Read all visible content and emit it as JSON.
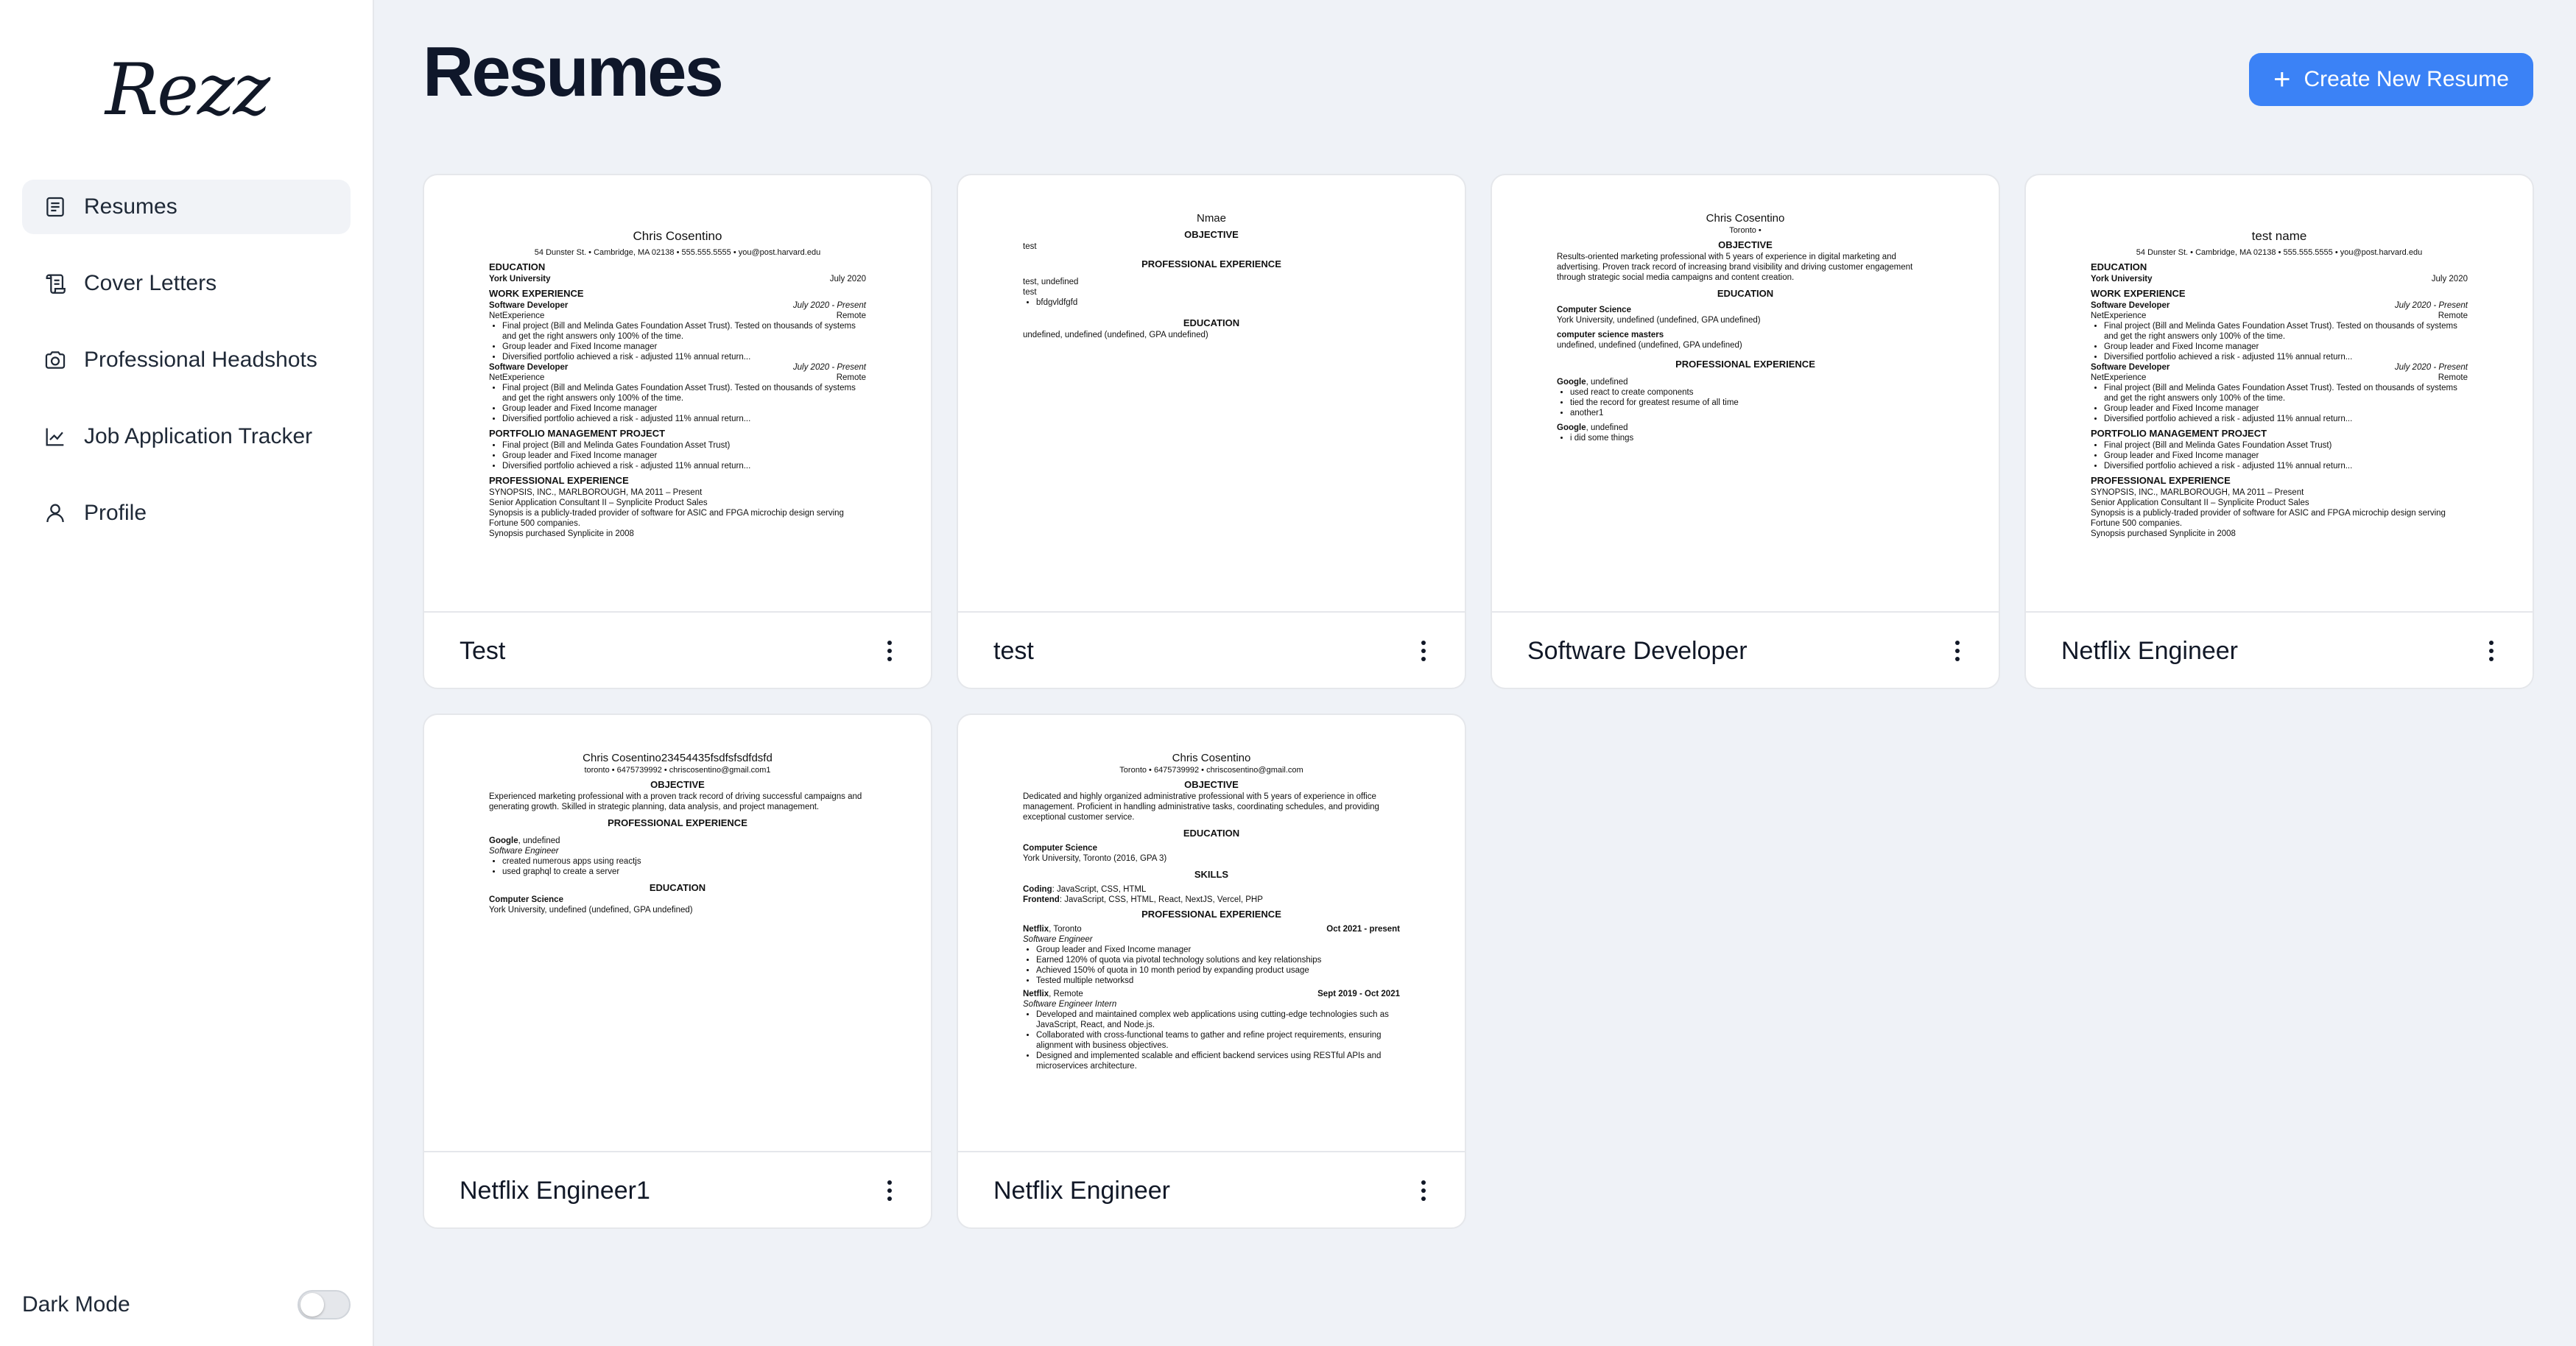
{
  "app": {
    "logo": "Rezz"
  },
  "sidebar": {
    "items": [
      {
        "label": "Resumes",
        "icon": "document-icon",
        "active": true
      },
      {
        "label": "Cover Letters",
        "icon": "scroll-icon",
        "active": false
      },
      {
        "label": "Professional Headshots",
        "icon": "camera-icon",
        "active": false
      },
      {
        "label": "Job Application Tracker",
        "icon": "chart-icon",
        "active": false
      },
      {
        "label": "Profile",
        "icon": "user-icon",
        "active": false
      }
    ],
    "dark_mode_label": "Dark Mode",
    "dark_mode_on": false
  },
  "header": {
    "title": "Resumes",
    "create_label": "Create New Resume",
    "accent": "#3b82f6"
  },
  "cards": [
    {
      "name": "Test",
      "preview": {
        "title": "Chris Cosentino",
        "contact": "54 Dunster St. • Cambridge, MA 02138 • 555.555.5555 • you@post.harvard.edu",
        "edu_heading": "EDUCATION",
        "edu_school": "York University",
        "edu_date": "July 2020",
        "work_heading": "WORK EXPERIENCE",
        "job1_title": "Software Developer",
        "job1_date": "July 2020 - Present",
        "job1_company": "NetExperience",
        "job1_loc": "Remote",
        "b1": "Final project (Bill and Melinda Gates Foundation Asset Trust). Tested on thousands of systems and get the right answers only 100% of the time.",
        "b2": "Group leader and Fixed Income manager",
        "b3": "Diversified portfolio achieved a risk - adjusted 11% annual return...",
        "proj_heading": "PORTFOLIO MANAGEMENT PROJECT",
        "pb1": "Final project (Bill and Melinda Gates Foundation Asset Trust)",
        "pb2": "Group leader and Fixed Income manager",
        "pb3": "Diversified portfolio achieved a risk - adjusted 11% annual return...",
        "pro_heading": "PROFESSIONAL EXPERIENCE",
        "pro1": "SYNOPSIS, INC., MARLBOROUGH, MA 2011 – Present",
        "pro2": "Senior Application Consultant II – Synplicite Product Sales",
        "pro3": "Synopsis is a publicly-traded provider of software for ASIC and FPGA microchip design serving Fortune 500 companies.",
        "pro4": "Synopsis purchased Synplicite in 2008"
      }
    },
    {
      "name": "test",
      "preview": {
        "title": "Nmae",
        "obj_heading": "OBJECTIVE",
        "obj_text": "test",
        "pro_heading": "PROFESSIONAL EXPERIENCE",
        "job_line": "test, undefined",
        "job_sub": "test",
        "bullet": "bfdgvldfgfd",
        "edu_heading": "EDUCATION",
        "edu_line": "undefined, undefined (undefined, GPA undefined)"
      }
    },
    {
      "name": "Software Developer",
      "preview": {
        "title": "Chris Cosentino",
        "contact": "Toronto •",
        "obj_heading": "OBJECTIVE",
        "obj_text": "Results-oriented marketing professional with 5 years of experience in digital marketing and advertising. Proven track record of increasing brand visibility and driving customer engagement through strategic social media campaigns and content creation.",
        "edu_heading": "EDUCATION",
        "edu1_title": "Computer Science",
        "edu1_line": "York University, undefined (undefined, GPA undefined)",
        "edu2_title": "computer science masters",
        "edu2_line": "undefined, undefined (undefined, GPA undefined)",
        "pro_heading": "PROFESSIONAL EXPERIENCE",
        "job1_company": "Google",
        "job1_rest": ", undefined",
        "b1": "used react to create components",
        "b2": "tied the record for greatest resume of all time",
        "b3": "another1",
        "job2_company": "Google",
        "job2_rest": ", undefined",
        "b4": "i did some things"
      }
    },
    {
      "name": "Netflix Engineer",
      "preview": {
        "title": "test name",
        "contact": "54 Dunster St. • Cambridge, MA 02138 • 555.555.5555 • you@post.harvard.edu",
        "edu_heading": "EDUCATION",
        "edu_school": "York University",
        "edu_date": "July 2020",
        "work_heading": "WORK EXPERIENCE",
        "job1_title": "Software Developer",
        "job1_date": "July 2020 - Present",
        "job1_company": "NetExperience",
        "job1_loc": "Remote",
        "b1": "Final project (Bill and Melinda Gates Foundation Asset Trust). Tested on thousands of systems and get the right answers only 100% of the time.",
        "b2": "Group leader and Fixed Income manager",
        "b3": "Diversified portfolio achieved a risk - adjusted 11% annual return...",
        "proj_heading": "PORTFOLIO MANAGEMENT PROJECT",
        "pb1": "Final project (Bill and Melinda Gates Foundation Asset Trust)",
        "pb2": "Group leader and Fixed Income manager",
        "pb3": "Diversified portfolio achieved a risk - adjusted 11% annual return...",
        "pro_heading": "PROFESSIONAL EXPERIENCE",
        "pro1": "SYNOPSIS, INC., MARLBOROUGH, MA 2011 – Present",
        "pro2": "Senior Application Consultant II – Synplicite Product Sales",
        "pro3": "Synopsis is a publicly-traded provider of software for ASIC and FPGA microchip design serving Fortune 500 companies.",
        "pro4": "Synopsis purchased Synplicite in 2008"
      }
    },
    {
      "name": "Netflix Engineer1",
      "preview": {
        "title": "Chris Cosentino23454435fsdfsfsdfdsfd",
        "contact": "toronto • 6475739992 • chriscosentino@gmail.com1",
        "obj_heading": "OBJECTIVE",
        "obj_text": "Experienced marketing professional with a proven track record of driving successful campaigns and generating growth. Skilled in strategic planning, data analysis, and project management.",
        "pro_heading": "PROFESSIONAL EXPERIENCE",
        "job_company": "Google",
        "job_rest": ", undefined",
        "job_role": "Software Engineer",
        "b1": "created numerous apps using reactjs",
        "b2": "used graphql to create a server",
        "edu_heading": "EDUCATION",
        "edu_title": "Computer Science",
        "edu_line": "York University, undefined (undefined, GPA undefined)"
      }
    },
    {
      "name": "Netflix Engineer",
      "preview": {
        "title": "Chris Cosentino",
        "contact": "Toronto • 6475739992 • chriscosentino@gmail.com",
        "obj_heading": "OBJECTIVE",
        "obj_text": "Dedicated and highly organized administrative professional with 5 years of experience in office management. Proficient in handling administrative tasks, coordinating schedules, and providing exceptional customer service.",
        "edu_heading": "EDUCATION",
        "edu_title": "Computer Science",
        "edu_line": "York University, Toronto (2016, GPA 3)",
        "skills_heading": "SKILLS",
        "skill1_label": "Coding",
        "skill1": ": JavaScript, CSS, HTML",
        "skill2_label": "Frontend",
        "skill2": ": JavaScript, CSS, HTML, React, NextJS, Vercel, PHP",
        "pro_heading": "PROFESSIONAL EXPERIENCE",
        "job1_company": "Netflix",
        "job1_loc": ", Toronto",
        "job1_date": "Oct 2021 - present",
        "job1_role": "Software Engineer",
        "b1": "Group leader and Fixed Income manager",
        "b2": "Earned 120% of quota via pivotal technology solutions and key relationships",
        "b3": "Achieved 150% of quota in 10 month period by expanding product usage",
        "b4": "Tested multiple networksd",
        "job2_company": "Netflix",
        "job2_loc": ", Remote",
        "job2_date": "Sept 2019 - Oct 2021",
        "job2_role": "Software Engineer Intern",
        "b5": "Developed and maintained complex web applications using cutting-edge technologies such as JavaScript, React, and Node.js.",
        "b6": "Collaborated with cross-functional teams to gather and refine project requirements, ensuring alignment with business objectives.",
        "b7": "Designed and implemented scalable and efficient backend services using RESTful APIs and microservices architecture."
      }
    }
  ]
}
